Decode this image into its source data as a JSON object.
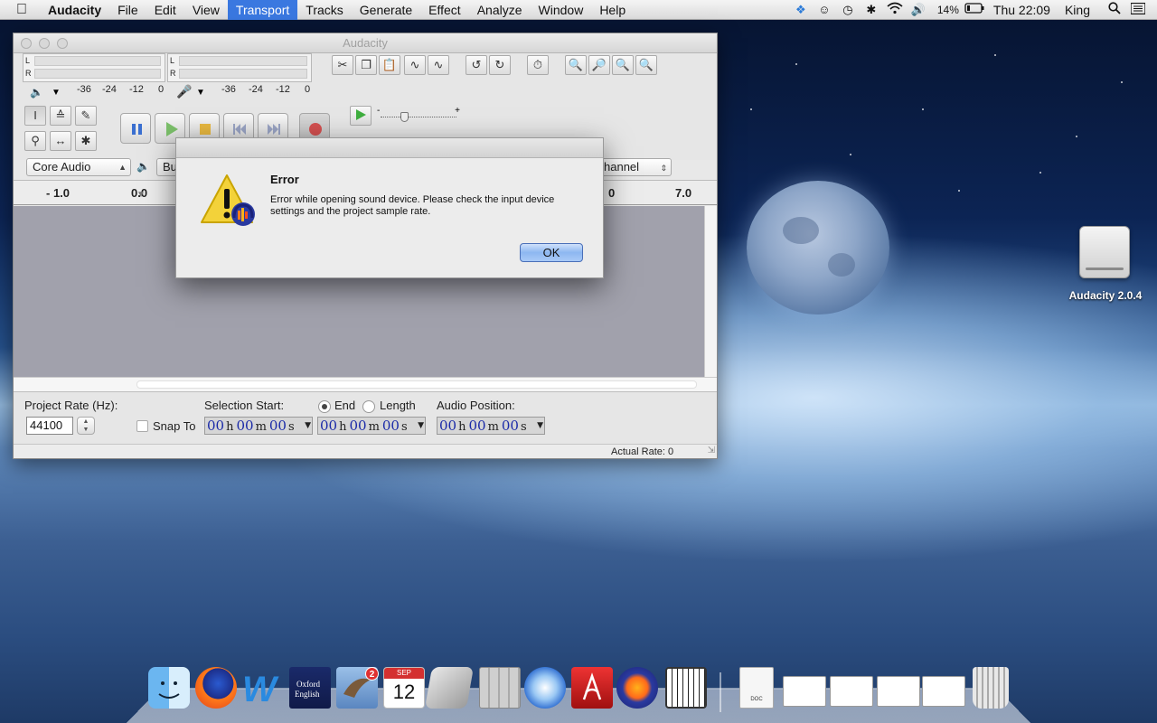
{
  "menubar": {
    "apple": "",
    "app_name": "Audacity",
    "items": [
      "File",
      "Edit",
      "View",
      "Transport",
      "Tracks",
      "Generate",
      "Effect",
      "Analyze",
      "Window",
      "Help"
    ],
    "active_item": "Transport",
    "battery": "14%",
    "clock": "Thu 22:09",
    "user": "King"
  },
  "window": {
    "title": "Audacity",
    "meters": {
      "play_l": "L",
      "play_r": "R",
      "rec_l": "L",
      "rec_r": "R",
      "scale_play": [
        "-36",
        "-24",
        "-12",
        "0"
      ],
      "scale_rec": [
        "-36",
        "-24",
        "-12",
        "0"
      ]
    },
    "device": {
      "host": "Core Audio",
      "output_partial": "Bu",
      "channels_partial": "hannel"
    },
    "ruler": {
      "labels": [
        "- 1.0",
        "0.0",
        "7.0",
        "0"
      ]
    },
    "selection_toolbar": {
      "project_rate_label": "Project Rate (Hz):",
      "project_rate_value": "44100",
      "snap_to_label": "Snap To",
      "selection_start_label": "Selection Start:",
      "end_label": "End",
      "length_label": "Length",
      "audio_position_label": "Audio Position:",
      "time": {
        "hh": "00",
        "h": "h",
        "mm": "00",
        "m": "m",
        "ss": "00",
        "s": "s"
      }
    },
    "status": {
      "actual_rate": "Actual Rate: 0"
    }
  },
  "dialog": {
    "heading": "Error",
    "message": "Error while opening sound device. Please check the input device settings and the project sample rate.",
    "ok_label": "OK"
  },
  "desktop": {
    "disk_label": "Audacity 2.0.4"
  },
  "dock": {
    "calendar_month": "SEP",
    "calendar_day": "12",
    "mail_badge": "2",
    "doc_label": "DOC"
  },
  "colors": {
    "menu_highlight": "#3a78e0",
    "time_digits": "#1a2aa8",
    "ok_button": "#8db7f1"
  }
}
